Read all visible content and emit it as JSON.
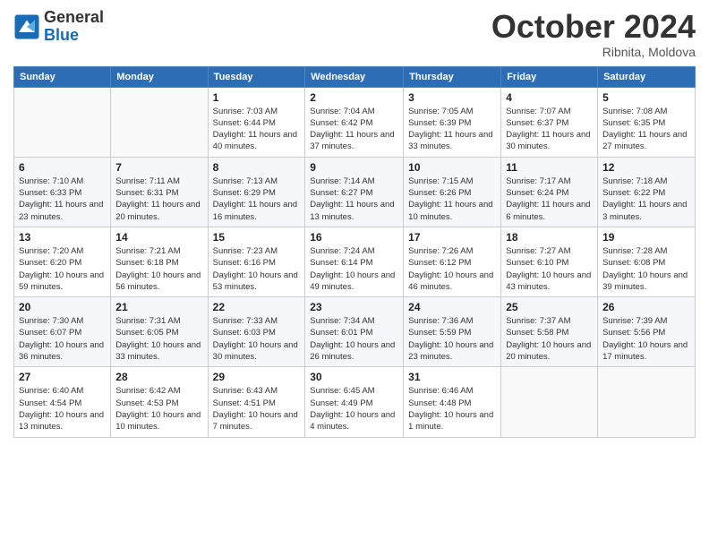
{
  "logo": {
    "line1": "General",
    "line2": "Blue"
  },
  "title": "October 2024",
  "subtitle": "Ribnita, Moldova",
  "days_header": [
    "Sunday",
    "Monday",
    "Tuesday",
    "Wednesday",
    "Thursday",
    "Friday",
    "Saturday"
  ],
  "weeks": [
    [
      {
        "num": "",
        "sunrise": "",
        "sunset": "",
        "daylight": ""
      },
      {
        "num": "",
        "sunrise": "",
        "sunset": "",
        "daylight": ""
      },
      {
        "num": "1",
        "sunrise": "Sunrise: 7:03 AM",
        "sunset": "Sunset: 6:44 PM",
        "daylight": "Daylight: 11 hours and 40 minutes."
      },
      {
        "num": "2",
        "sunrise": "Sunrise: 7:04 AM",
        "sunset": "Sunset: 6:42 PM",
        "daylight": "Daylight: 11 hours and 37 minutes."
      },
      {
        "num": "3",
        "sunrise": "Sunrise: 7:05 AM",
        "sunset": "Sunset: 6:39 PM",
        "daylight": "Daylight: 11 hours and 33 minutes."
      },
      {
        "num": "4",
        "sunrise": "Sunrise: 7:07 AM",
        "sunset": "Sunset: 6:37 PM",
        "daylight": "Daylight: 11 hours and 30 minutes."
      },
      {
        "num": "5",
        "sunrise": "Sunrise: 7:08 AM",
        "sunset": "Sunset: 6:35 PM",
        "daylight": "Daylight: 11 hours and 27 minutes."
      }
    ],
    [
      {
        "num": "6",
        "sunrise": "Sunrise: 7:10 AM",
        "sunset": "Sunset: 6:33 PM",
        "daylight": "Daylight: 11 hours and 23 minutes."
      },
      {
        "num": "7",
        "sunrise": "Sunrise: 7:11 AM",
        "sunset": "Sunset: 6:31 PM",
        "daylight": "Daylight: 11 hours and 20 minutes."
      },
      {
        "num": "8",
        "sunrise": "Sunrise: 7:13 AM",
        "sunset": "Sunset: 6:29 PM",
        "daylight": "Daylight: 11 hours and 16 minutes."
      },
      {
        "num": "9",
        "sunrise": "Sunrise: 7:14 AM",
        "sunset": "Sunset: 6:27 PM",
        "daylight": "Daylight: 11 hours and 13 minutes."
      },
      {
        "num": "10",
        "sunrise": "Sunrise: 7:15 AM",
        "sunset": "Sunset: 6:26 PM",
        "daylight": "Daylight: 11 hours and 10 minutes."
      },
      {
        "num": "11",
        "sunrise": "Sunrise: 7:17 AM",
        "sunset": "Sunset: 6:24 PM",
        "daylight": "Daylight: 11 hours and 6 minutes."
      },
      {
        "num": "12",
        "sunrise": "Sunrise: 7:18 AM",
        "sunset": "Sunset: 6:22 PM",
        "daylight": "Daylight: 11 hours and 3 minutes."
      }
    ],
    [
      {
        "num": "13",
        "sunrise": "Sunrise: 7:20 AM",
        "sunset": "Sunset: 6:20 PM",
        "daylight": "Daylight: 10 hours and 59 minutes."
      },
      {
        "num": "14",
        "sunrise": "Sunrise: 7:21 AM",
        "sunset": "Sunset: 6:18 PM",
        "daylight": "Daylight: 10 hours and 56 minutes."
      },
      {
        "num": "15",
        "sunrise": "Sunrise: 7:23 AM",
        "sunset": "Sunset: 6:16 PM",
        "daylight": "Daylight: 10 hours and 53 minutes."
      },
      {
        "num": "16",
        "sunrise": "Sunrise: 7:24 AM",
        "sunset": "Sunset: 6:14 PM",
        "daylight": "Daylight: 10 hours and 49 minutes."
      },
      {
        "num": "17",
        "sunrise": "Sunrise: 7:26 AM",
        "sunset": "Sunset: 6:12 PM",
        "daylight": "Daylight: 10 hours and 46 minutes."
      },
      {
        "num": "18",
        "sunrise": "Sunrise: 7:27 AM",
        "sunset": "Sunset: 6:10 PM",
        "daylight": "Daylight: 10 hours and 43 minutes."
      },
      {
        "num": "19",
        "sunrise": "Sunrise: 7:28 AM",
        "sunset": "Sunset: 6:08 PM",
        "daylight": "Daylight: 10 hours and 39 minutes."
      }
    ],
    [
      {
        "num": "20",
        "sunrise": "Sunrise: 7:30 AM",
        "sunset": "Sunset: 6:07 PM",
        "daylight": "Daylight: 10 hours and 36 minutes."
      },
      {
        "num": "21",
        "sunrise": "Sunrise: 7:31 AM",
        "sunset": "Sunset: 6:05 PM",
        "daylight": "Daylight: 10 hours and 33 minutes."
      },
      {
        "num": "22",
        "sunrise": "Sunrise: 7:33 AM",
        "sunset": "Sunset: 6:03 PM",
        "daylight": "Daylight: 10 hours and 30 minutes."
      },
      {
        "num": "23",
        "sunrise": "Sunrise: 7:34 AM",
        "sunset": "Sunset: 6:01 PM",
        "daylight": "Daylight: 10 hours and 26 minutes."
      },
      {
        "num": "24",
        "sunrise": "Sunrise: 7:36 AM",
        "sunset": "Sunset: 5:59 PM",
        "daylight": "Daylight: 10 hours and 23 minutes."
      },
      {
        "num": "25",
        "sunrise": "Sunrise: 7:37 AM",
        "sunset": "Sunset: 5:58 PM",
        "daylight": "Daylight: 10 hours and 20 minutes."
      },
      {
        "num": "26",
        "sunrise": "Sunrise: 7:39 AM",
        "sunset": "Sunset: 5:56 PM",
        "daylight": "Daylight: 10 hours and 17 minutes."
      }
    ],
    [
      {
        "num": "27",
        "sunrise": "Sunrise: 6:40 AM",
        "sunset": "Sunset: 4:54 PM",
        "daylight": "Daylight: 10 hours and 13 minutes."
      },
      {
        "num": "28",
        "sunrise": "Sunrise: 6:42 AM",
        "sunset": "Sunset: 4:53 PM",
        "daylight": "Daylight: 10 hours and 10 minutes."
      },
      {
        "num": "29",
        "sunrise": "Sunrise: 6:43 AM",
        "sunset": "Sunset: 4:51 PM",
        "daylight": "Daylight: 10 hours and 7 minutes."
      },
      {
        "num": "30",
        "sunrise": "Sunrise: 6:45 AM",
        "sunset": "Sunset: 4:49 PM",
        "daylight": "Daylight: 10 hours and 4 minutes."
      },
      {
        "num": "31",
        "sunrise": "Sunrise: 6:46 AM",
        "sunset": "Sunset: 4:48 PM",
        "daylight": "Daylight: 10 hours and 1 minute."
      },
      {
        "num": "",
        "sunrise": "",
        "sunset": "",
        "daylight": ""
      },
      {
        "num": "",
        "sunrise": "",
        "sunset": "",
        "daylight": ""
      }
    ]
  ]
}
